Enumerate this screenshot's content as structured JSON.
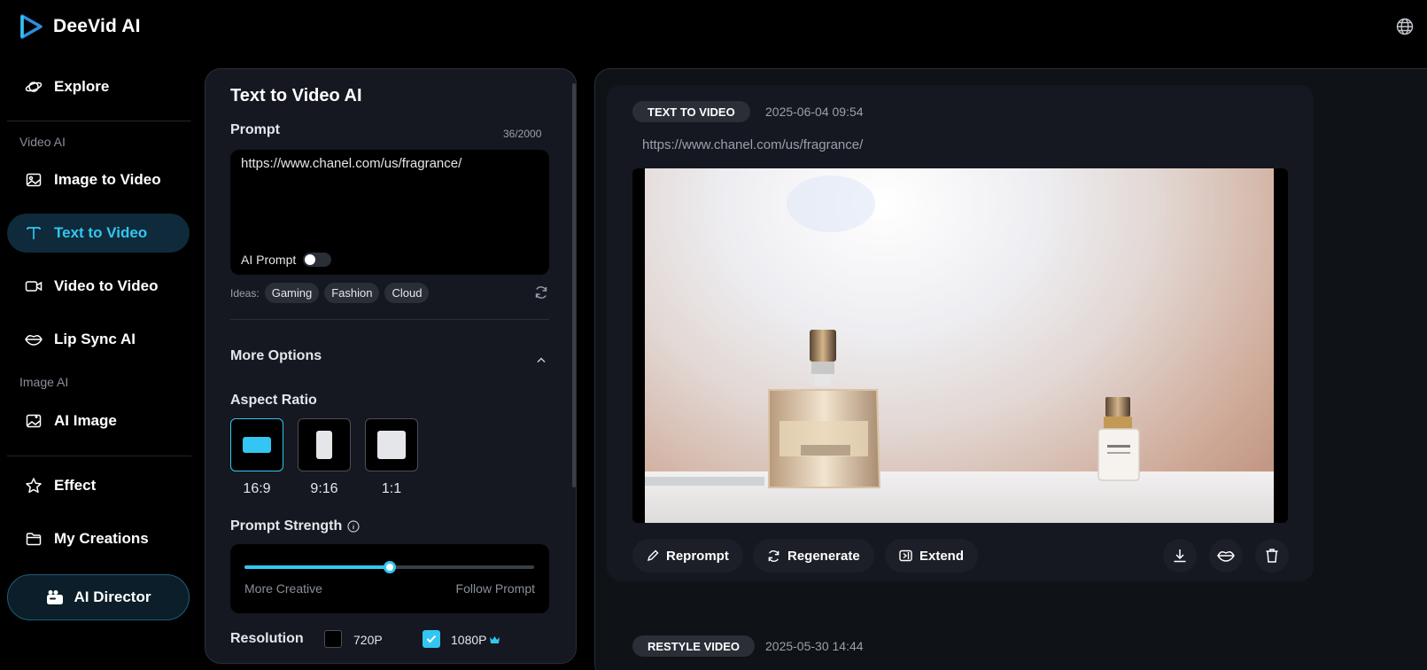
{
  "app": {
    "name": "DeeVid AI"
  },
  "header": {
    "globe_icon": "globe-icon"
  },
  "sidebar": {
    "explore": "Explore",
    "video_section": "Video AI",
    "image_to_video": "Image to Video",
    "text_to_video": "Text to Video",
    "video_to_video": "Video to Video",
    "lip_sync": "Lip Sync AI",
    "image_section": "Image AI",
    "ai_image": "AI Image",
    "effect": "Effect",
    "my_creations": "My Creations",
    "ai_director": "AI Director"
  },
  "panel": {
    "title": "Text to Video AI",
    "prompt_label": "Prompt",
    "counter": "36/2000",
    "prompt_value": "https://www.chanel.com/us/fragrance/",
    "ai_prompt_label": "AI Prompt",
    "ai_prompt_on": false,
    "ideas_label": "Ideas:",
    "ideas": [
      "Gaming",
      "Fashion",
      "Cloud"
    ],
    "more_options": "More Options",
    "aspect_label": "Aspect Ratio",
    "ratios": [
      "16:9",
      "9:16",
      "1:1"
    ],
    "selected_ratio": "16:9",
    "strength_label": "Prompt Strength",
    "strength_value": 0.5,
    "slider_left": "More Creative",
    "slider_right": "Follow Prompt",
    "resolution_label": "Resolution",
    "res_720": "720P",
    "res_1080": "1080P",
    "res_1080_checked": true
  },
  "feed": {
    "item1": {
      "tag": "TEXT TO VIDEO",
      "date": "2025-06-04 09:54",
      "url": "https://www.chanel.com/us/fragrance/",
      "reprompt": "Reprompt",
      "regenerate": "Regenerate",
      "extend": "Extend"
    },
    "item2": {
      "tag": "RESTYLE VIDEO",
      "date": "2025-05-30 14:44"
    }
  },
  "colors": {
    "accent": "#33c6f2",
    "bg": "#000000",
    "panel": "#151820"
  }
}
